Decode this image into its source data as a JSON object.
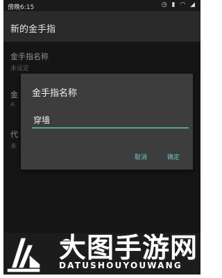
{
  "status_bar": {
    "time": "傍晚6:15",
    "icons": [
      "alarm-icon",
      "battery-icon",
      "wifi-icon",
      "signal-icon"
    ]
  },
  "app_bar": {
    "title": "新的金手指"
  },
  "prefs": [
    {
      "title": "金手指名称",
      "summary": "未设定"
    },
    {
      "title": "金",
      "summary": "A"
    },
    {
      "title": "代",
      "summary": "未"
    }
  ],
  "dialog": {
    "title": "金手指名称",
    "input_value": "穿墙",
    "cancel_label": "取消",
    "ok_label": "确定"
  },
  "watermark": {
    "title": "大图手游网",
    "subtitle": "DATUSHOUYOUWANG"
  },
  "colors": {
    "accent": "#4fa7a2",
    "dialog_bg": "#3d3d3d",
    "screen_bg": "#212121",
    "button_text": "#6fc3c0"
  }
}
